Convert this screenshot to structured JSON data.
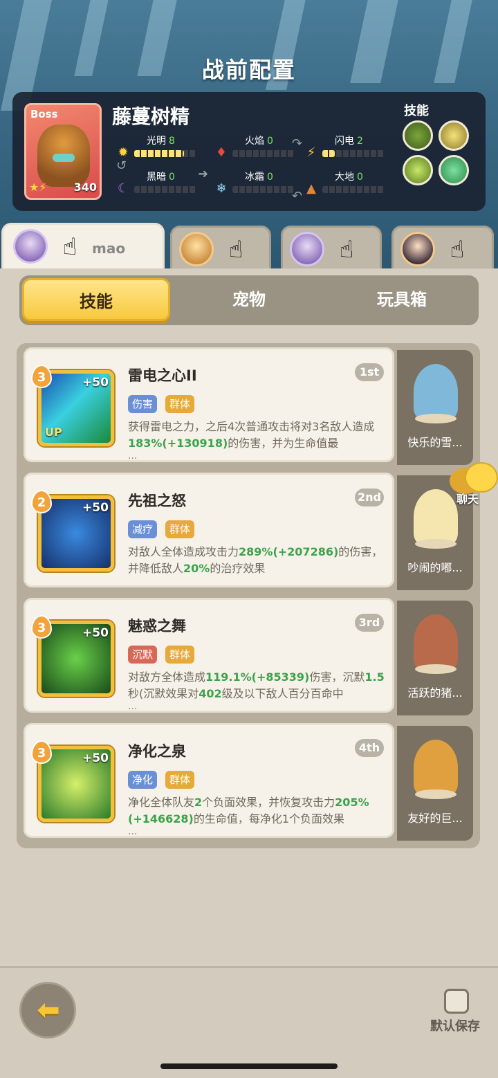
{
  "header": {
    "title": "战前配置"
  },
  "boss": {
    "tag": "Boss",
    "name": "藤蔓树精",
    "level": "340",
    "stats": [
      {
        "label": "光明",
        "value": "8",
        "icon": "sun-icon",
        "fill": 0.8
      },
      {
        "label": "火焰",
        "value": "0",
        "icon": "fire-icon",
        "fill": 0
      },
      {
        "label": "闪电",
        "value": "2",
        "icon": "lightning-icon",
        "fill": 0.2
      },
      {
        "label": "黑暗",
        "value": "0",
        "icon": "moon-icon",
        "fill": 0
      },
      {
        "label": "冰霜",
        "value": "0",
        "icon": "snowflake-icon",
        "fill": 0
      },
      {
        "label": "大地",
        "value": "0",
        "icon": "earth-icon",
        "fill": 0
      }
    ],
    "skills_label": "技能"
  },
  "players": [
    {
      "name": "mao",
      "active": true
    },
    {
      "name": "",
      "active": false
    },
    {
      "name": "",
      "active": false
    },
    {
      "name": "",
      "active": false
    }
  ],
  "segments": {
    "skills": "技能",
    "pets": "宠物",
    "toybox": "玩具箱",
    "active": "skills"
  },
  "cards": [
    {
      "level": "3",
      "plus": "+50",
      "up": "UP",
      "name": "雷电之心II",
      "rank": "1st",
      "tags": [
        "伤害",
        "群体"
      ],
      "desc_parts": [
        "获得雷电之力，之后4次普通攻击将对3名敌人造成",
        "183%(+130918)",
        "的伤害，并为生命值最"
      ],
      "more": "...",
      "pet": "快乐的雪..."
    },
    {
      "level": "2",
      "plus": "+50",
      "up": "",
      "name": "先祖之怒",
      "rank": "2nd",
      "tags": [
        "减疗",
        "群体"
      ],
      "desc_parts": [
        "对敌人全体造成攻击力",
        "289%(+207286)",
        "的伤害，并降低敌人",
        "20%",
        "的治疗效果"
      ],
      "more": "",
      "pet": "吵闹的嘟..."
    },
    {
      "level": "3",
      "plus": "+50",
      "up": "",
      "name": "魅惑之舞",
      "rank": "3rd",
      "tags": [
        "沉默",
        "群体"
      ],
      "desc_parts": [
        "对敌方全体造成",
        "119.1%(+85339)",
        "伤害，沉默",
        "1.5",
        "秒(沉默效果对",
        "402",
        "级及以下敌人百分百命中"
      ],
      "more": "...",
      "pet": "活跃的猪..."
    },
    {
      "level": "3",
      "plus": "+50",
      "up": "",
      "name": "净化之泉",
      "rank": "4th",
      "tags": [
        "净化",
        "群体"
      ],
      "desc_parts": [
        "净化全体队友",
        "2",
        "个负面效果，并恢复攻击力",
        "205%(+146628)",
        "的生命值，每净化1个负面效果"
      ],
      "more": "...",
      "pet": "友好的巨..."
    }
  ],
  "chat": {
    "label": "聊天"
  },
  "footer": {
    "save_label": "默认保存"
  }
}
